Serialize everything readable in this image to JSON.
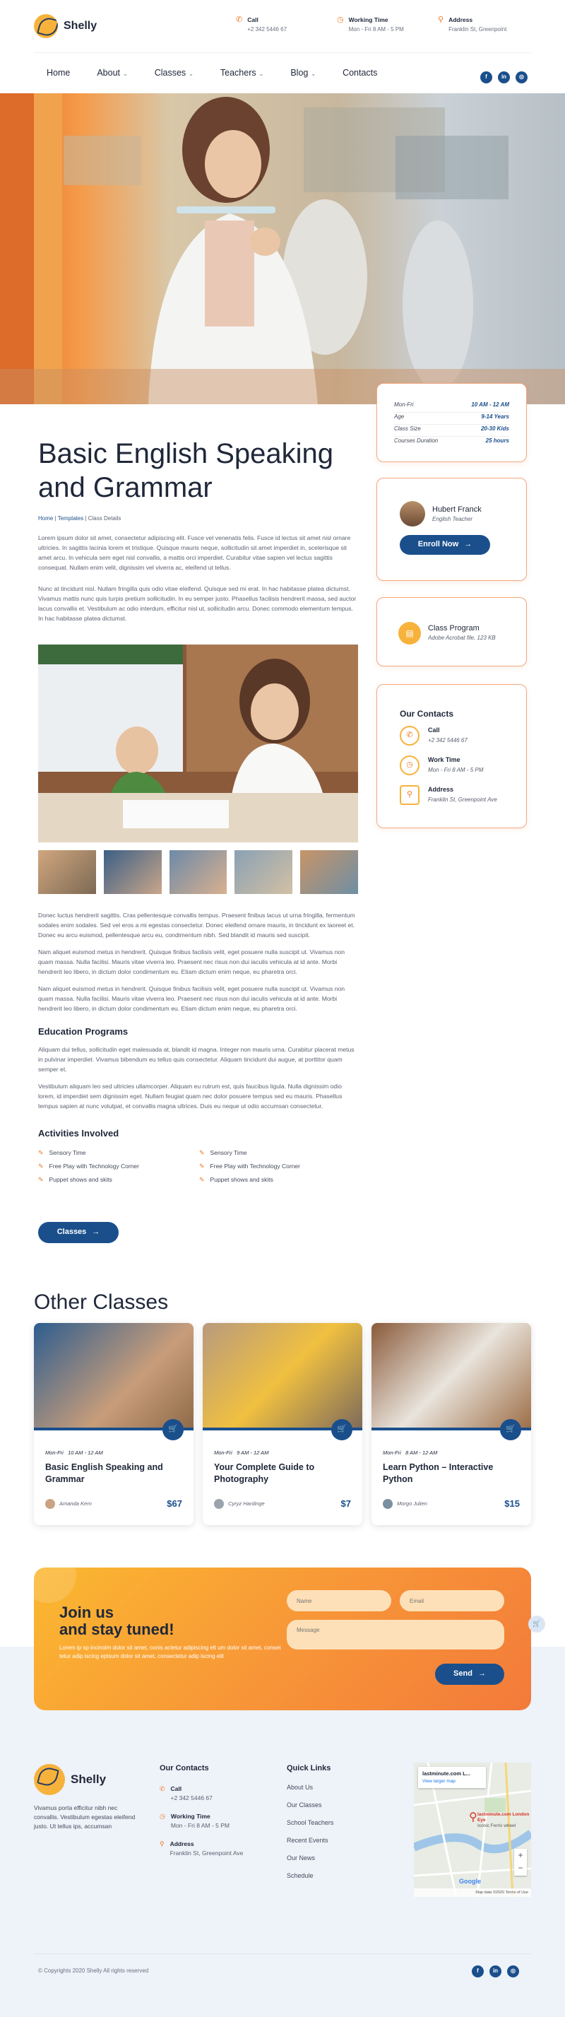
{
  "brand": {
    "name": "Shelly"
  },
  "header": {
    "call": {
      "label": "Call",
      "value": "+2 342 5446 67"
    },
    "hours": {
      "label": "Working Time",
      "value": "Mon - Fri 8 AM - 5 PM"
    },
    "address": {
      "label": "Address",
      "value": "Franklin St, Greenpoint"
    }
  },
  "nav": [
    {
      "label": "Home",
      "caret": false
    },
    {
      "label": "About",
      "caret": true
    },
    {
      "label": "Classes",
      "caret": true
    },
    {
      "label": "Teachers",
      "caret": true
    },
    {
      "label": "Blog",
      "caret": true
    },
    {
      "label": "Contacts",
      "caret": false
    }
  ],
  "social": [
    "f",
    "in",
    "◎"
  ],
  "details": [
    {
      "label": "Mon-Fri",
      "value": "10 AM - 12 AM"
    },
    {
      "label": "Age",
      "value": "9-14 Years"
    },
    {
      "label": "Class Size",
      "value": "20-30 Kids"
    },
    {
      "label": "Courses Duration",
      "value": "25 hours"
    }
  ],
  "teacher": {
    "name": "Hubert Franck",
    "role": "English Teacher",
    "button": "Enroll Now"
  },
  "program": {
    "title": "Class Program",
    "file": "Adobe Acrobat file, 123 KB"
  },
  "contacts": {
    "title": "Our Contacts",
    "call_label": "Call",
    "call": "+2 342 5446 67",
    "work_label": "Work Time",
    "work": "Mon - Fri 8 AM - 5 PM",
    "address_label": "Address",
    "address": "Franklin St, Greenpoint Ave"
  },
  "course": {
    "title_line1": "Basic English Speaking",
    "title_line2": "and Grammar",
    "breadcrumb": {
      "home": "Home",
      "templates": "Templates",
      "current": "Class Details"
    },
    "p1": "Lorem ipsum dolor sit amet, consectetur adipiscing elit. Fusce vel venenatis felis. Fusce id lectus sit amet nisl ornare ultricies. In sagittis lacinia lorem et tristique. Quisque mauris neque, sollicitudin sit amet imperdiet in, scelerisque sit amet arcu. In vehicula sem eget nisl convallis, a mattis orci imperdiet. Curabitur vitae sapien vel lectus sagittis consequat. Nullam enim velit, dignissim vel viverra ac, eleifend ut tellus.",
    "p2": "Nunc at tincidunt nisl. Nullam fringilla quis odio vitae eleifend. Quisque sed mi erat. In hac habitasse platea dictumst. Vivamus mattis nunc quis turpis pretium sollicitudin. In eu semper justo. Phasellus facilisis hendrerit massa, sed auctor lacus convallis et. Vestibulum ac odio interdum, efficitur nisl ut, sollicitudin arcu. Donec commodo elementum tempus. In hac habitasse platea dictumst.",
    "p3": "Donec luctus hendrerit sagittis. Cras pellentesque convallis tempus. Praesent finibus lacus ut urna fringilla, fermentum sodales enim sodales. Sed vel eros a mi egestas consectetur. Donec eleifend ornare mauris, in tincidunt ex laoreet et. Donec eu arcu euismod, pellentesque arcu eu, condimentum nibh. Sed blandit id mauris sed suscipit.",
    "p4": "Nam aliquet euismod metus in hendrerit. Quisque finibus facilisis velit, eget posuere nulla suscipit ut. Vivamus non quam massa. Nulla facilisi. Mauris vitae viverra leo. Praesent nec risus non dui iaculis vehicula at id ante. Morbi hendrerit leo libero, in dictum dolor condimentum eu. Etiam dictum enim neque, eu pharetra orci.",
    "p5": "Nam aliquet euismod metus in hendrerit. Quisque finibus facilisis velit, eget posuere nulla suscipit ut. Vivamus non quam massa. Nulla facilisi. Mauris vitae viverra leo. Praesent nec risus non dui iaculis vehicula at id ante. Morbi hendrerit leo libero, in dictum dolor condimentum eu. Etiam dictum enim neque, eu pharetra orci.",
    "edu_title": "Education Programs",
    "p6": "Aliquam dui tellus, sollicitudin eget malesuada at, blandit id magna. Integer non mauris urna. Curabitur placerat metus in pulvinar imperdiet. Vivamus bibendum eu tellus quis consectetur. Aliquam tincidunt dui augue, at porttitor quam semper et.",
    "p7": "Vestibulum aliquam leo sed ultricies ullamcorper. Aliquam eu rutrum est, quis faucibus ligula. Nulla dignissim odio lorem, id imperdiet sem dignissim eget. Nullam feugiat quam nec dolor posuere tempus sed eu mauris. Phasellus tempus sapien at nunc volutpat, et convallis magna ultrices. Duis eu neque ut odio accumsan consectetur.",
    "act_title": "Activities Involved",
    "activities": [
      "Sensory Time",
      "Free Play with Technology Corner",
      "Puppet shows and skits",
      "Sensory Time",
      "Free Play with Technology Corner",
      "Puppet shows and skits"
    ],
    "button": "Classes"
  },
  "other": {
    "title": "Other Classes",
    "items": [
      {
        "time": "Mon-Fri",
        "hours": "10 AM - 12 AM",
        "title1": "Basic English Speaking and",
        "title2": "Grammar",
        "teacher": "Amanda Kern",
        "price": "$67"
      },
      {
        "time": "Mon-Fri",
        "hours": "9 AM - 12 AM",
        "title1": "Your Complete Guide to",
        "title2": "Photography",
        "teacher": "Cyryz Hardinge",
        "price": "$7"
      },
      {
        "time": "Mon-Fri",
        "hours": "8 AM - 12 AM",
        "title1": "Learn Python – Interactive",
        "title2": "Python",
        "teacher": "Morgo Julien",
        "price": "$15"
      }
    ]
  },
  "subscribe": {
    "title1": "Join us",
    "title2": "and stay tuned!",
    "text": "Lorem ip sp incinolm dolor sit amet, conis actetur adipiscing elt um dolor sit amet, conset tetur adip iscing eptsum dolor sit amet, consectetur adip iscing elit",
    "name": "Name",
    "email": "Email",
    "message": "Message",
    "send": "Send"
  },
  "footer": {
    "about": "Vivamus porta efficitur nibh nec convallis. Vestibulum egestas eleifend justo. Ut tellus ips, accumsan",
    "contacts_title": "Our Contacts",
    "call_label": "Call",
    "call": "+2 342 5446 67",
    "work_label": "Working Time",
    "work": "Mon - Fri 8 AM - 5 PM",
    "address_label": "Address",
    "address": "Franklin St, Greenpoint Ave",
    "links_title": "Quick Links",
    "links": [
      "About Us",
      "Our Classes",
      "School Teachers",
      "Recent Events",
      "Our News",
      "Schedule"
    ],
    "map": {
      "site": "lastminute.com L...",
      "view": "View larger map",
      "pin": "lastminute.com London Eye",
      "pin2": "Iconic Ferris wheel",
      "credit": "Google",
      "footer_text": "Map data ©2020   Terms of Use"
    },
    "copyright": "© Copyrights 2020 Shelly All rights reserved"
  }
}
